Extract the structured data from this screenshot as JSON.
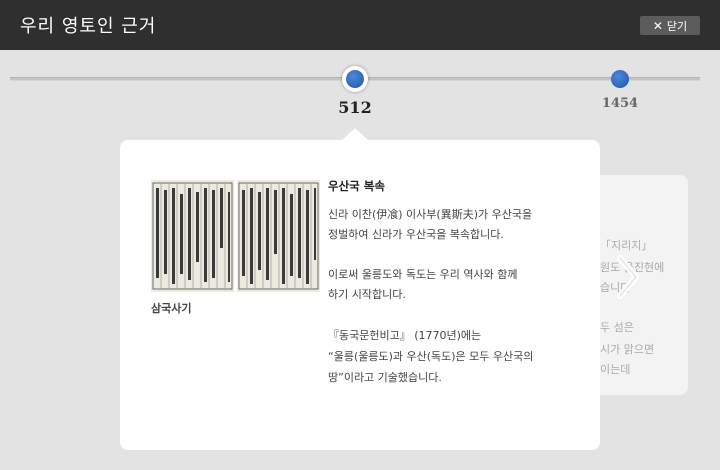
{
  "header": {
    "title": "우리 영토인 근거",
    "close_label": "닫기"
  },
  "timeline": {
    "active_year": "512",
    "next_year": "1454"
  },
  "card": {
    "image_caption": "삼국사기",
    "heading": "우산국 복속",
    "lines": [
      "신라 이찬(伊飡) 이사부(異斯夫)가 우산국을",
      "정벌하여 신라가 우산국을 복속합니다.",
      "이로써 울릉도와 독도는 우리 역사와 함께",
      "하기 시작합니다.",
      "『동국문헌비고』 (1770년)에는",
      "“울릉(울릉도)과 우산(독도)은 모두 우산국의",
      "땅”이라고 기술했습니다."
    ]
  },
  "back_card": {
    "lines": [
      "「지리지」",
      "원도 울진현에",
      "습니다",
      "두 섬은",
      "시가 맑으면",
      "이는데"
    ]
  },
  "colors": {
    "header_bg": "#2f2f2f",
    "accent_blue": "#2a5fb8",
    "background": "#e3e3e3"
  }
}
